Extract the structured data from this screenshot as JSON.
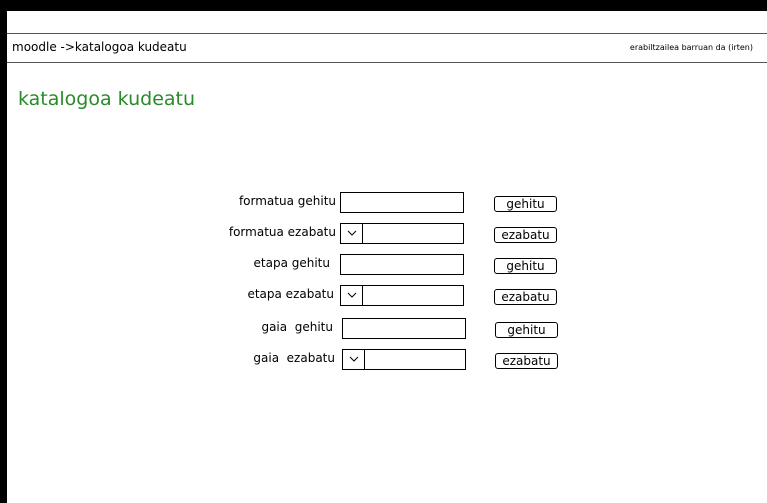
{
  "header": {
    "breadcrumb": "moodle ->katalogoa kudeatu",
    "login_info": "erabiltzailea barruan da (irten)"
  },
  "page": {
    "title": "katalogoa kudeatu"
  },
  "form": {
    "rows": [
      {
        "label": "formatua gehitu",
        "control": "text",
        "value": "",
        "button": "gehitu"
      },
      {
        "label": "formatua ezabatu",
        "control": "select",
        "selected": "",
        "button": "ezabatu"
      },
      {
        "label": "etapa gehitu",
        "control": "text",
        "value": "",
        "button": "gehitu"
      },
      {
        "label": "etapa ezabatu",
        "control": "select",
        "selected": "",
        "button": "ezabatu"
      },
      {
        "label": "gaia  gehitu",
        "control": "text",
        "value": "",
        "button": "gehitu"
      },
      {
        "label": "gaia  ezabatu",
        "control": "select",
        "selected": "",
        "button": "ezabatu"
      }
    ]
  },
  "icons": {
    "select_arrow": "chevron-down-icon"
  },
  "colors": {
    "title_green": "#2a8a2a",
    "frame_black": "#000000"
  }
}
